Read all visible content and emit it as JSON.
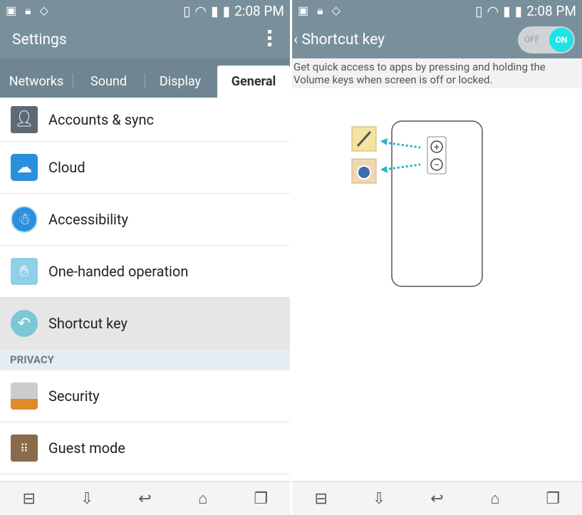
{
  "status": {
    "time": "2:08 PM"
  },
  "left": {
    "title": "Settings",
    "tabs": [
      {
        "label": "Networks"
      },
      {
        "label": "Sound"
      },
      {
        "label": "Display"
      },
      {
        "label": "General"
      }
    ],
    "items": [
      {
        "label": "Accounts & sync",
        "icon": "accounts-icon"
      },
      {
        "label": "Cloud",
        "icon": "cloud-icon"
      },
      {
        "label": "Accessibility",
        "icon": "accessibility-icon"
      },
      {
        "label": "One-handed operation",
        "icon": "one-handed-icon"
      },
      {
        "label": "Shortcut key",
        "icon": "shortcut-icon"
      }
    ],
    "section": "PRIVACY",
    "items2": [
      {
        "label": "Security",
        "icon": "lock-icon"
      },
      {
        "label": "Guest mode",
        "icon": "guest-icon"
      }
    ]
  },
  "right": {
    "title": "Shortcut key",
    "toggle": {
      "off": "OFF",
      "on": "ON",
      "state": "on"
    },
    "description": "Get quick access to apps by pressing and holding the Volume keys when screen is off or locked."
  },
  "colors": {
    "bar": "#7a8f9c",
    "accent": "#1ee3e6"
  }
}
